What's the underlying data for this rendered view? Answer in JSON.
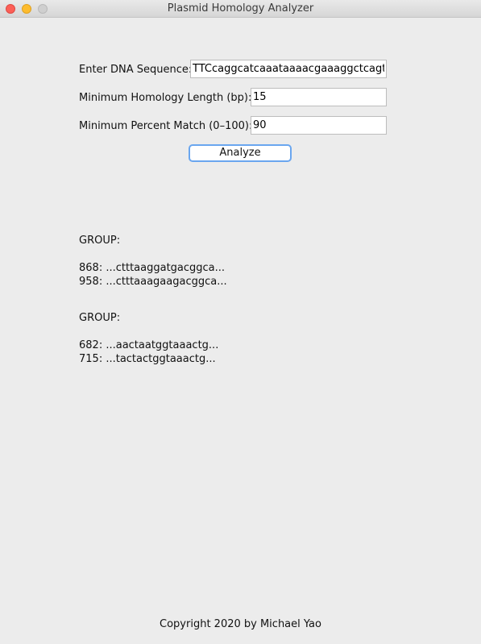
{
  "window": {
    "title": "Plasmid Homology Analyzer"
  },
  "form": {
    "sequence_label": "Enter DNA Sequence:",
    "sequence_value": "TTCcaggcatcaaataaaacgaaaggctcagtcg",
    "min_length_label": "Minimum Homology Length (bp):",
    "min_length_value": "15",
    "min_percent_label": "Minimum Percent Match (0–100):",
    "min_percent_value": "90",
    "analyze_label": "Analyze"
  },
  "results": {
    "groups": [
      {
        "title": "GROUP:",
        "matches": [
          "868: ...ctttaaggatgacggca...",
          "958: ...ctttaaagaagacggca..."
        ]
      },
      {
        "title": "GROUP:",
        "matches": [
          "682: ...aactaatggtaaactg...",
          "715: ...tactactggtaaactg..."
        ]
      }
    ]
  },
  "footer": {
    "text": "Copyright 2020 by Michael Yao"
  }
}
